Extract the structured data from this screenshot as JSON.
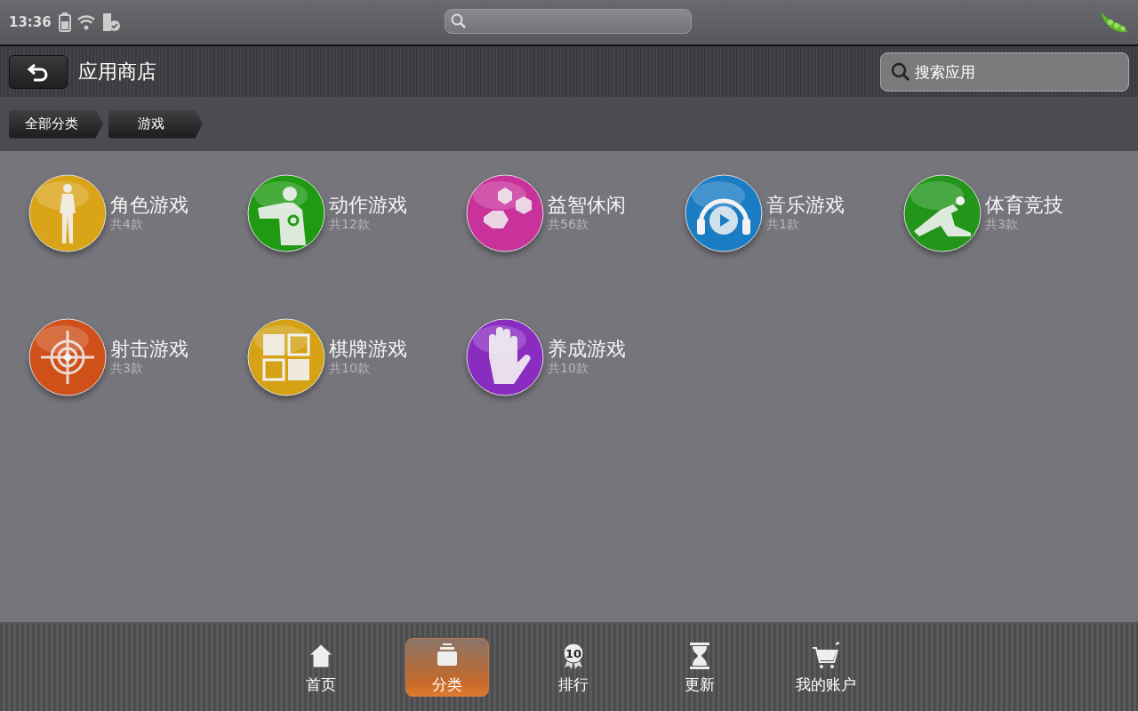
{
  "status_bar": {
    "time": "13:36"
  },
  "title_bar": {
    "title": "应用商店",
    "search": {
      "placeholder": "搜索应用"
    }
  },
  "breadcrumbs": [
    "全部分类",
    "游戏"
  ],
  "categories": [
    {
      "name": "角色游戏",
      "count": "共4款",
      "kind": "figure",
      "color": "#d9a418"
    },
    {
      "name": "动作游戏",
      "count": "共12款",
      "kind": "fighter",
      "color": "#1f9a12"
    },
    {
      "name": "益智休闲",
      "count": "共56款",
      "kind": "hexagons",
      "color": "#c8329a"
    },
    {
      "name": "音乐游戏",
      "count": "共1款",
      "kind": "headphones",
      "color": "#1a7dc4"
    },
    {
      "name": "体育竞技",
      "count": "共3款",
      "kind": "runner",
      "color": "#22951a"
    },
    {
      "name": "射击游戏",
      "count": "共3款",
      "kind": "target",
      "color": "#d0501a"
    },
    {
      "name": "棋牌游戏",
      "count": "共10款",
      "kind": "squares",
      "color": "#d4a214"
    },
    {
      "name": "养成游戏",
      "count": "共10款",
      "kind": "hand",
      "color": "#8a2cc0"
    }
  ],
  "tabs": [
    {
      "label": "首页",
      "kind": "home",
      "selected": false
    },
    {
      "label": "分类",
      "kind": "trays",
      "selected": true
    },
    {
      "label": "排行",
      "kind": "medal",
      "icon_text": "10",
      "selected": false
    },
    {
      "label": "更新",
      "kind": "hourglass",
      "selected": false
    },
    {
      "label": "我的账户",
      "kind": "cart",
      "selected": false
    }
  ]
}
